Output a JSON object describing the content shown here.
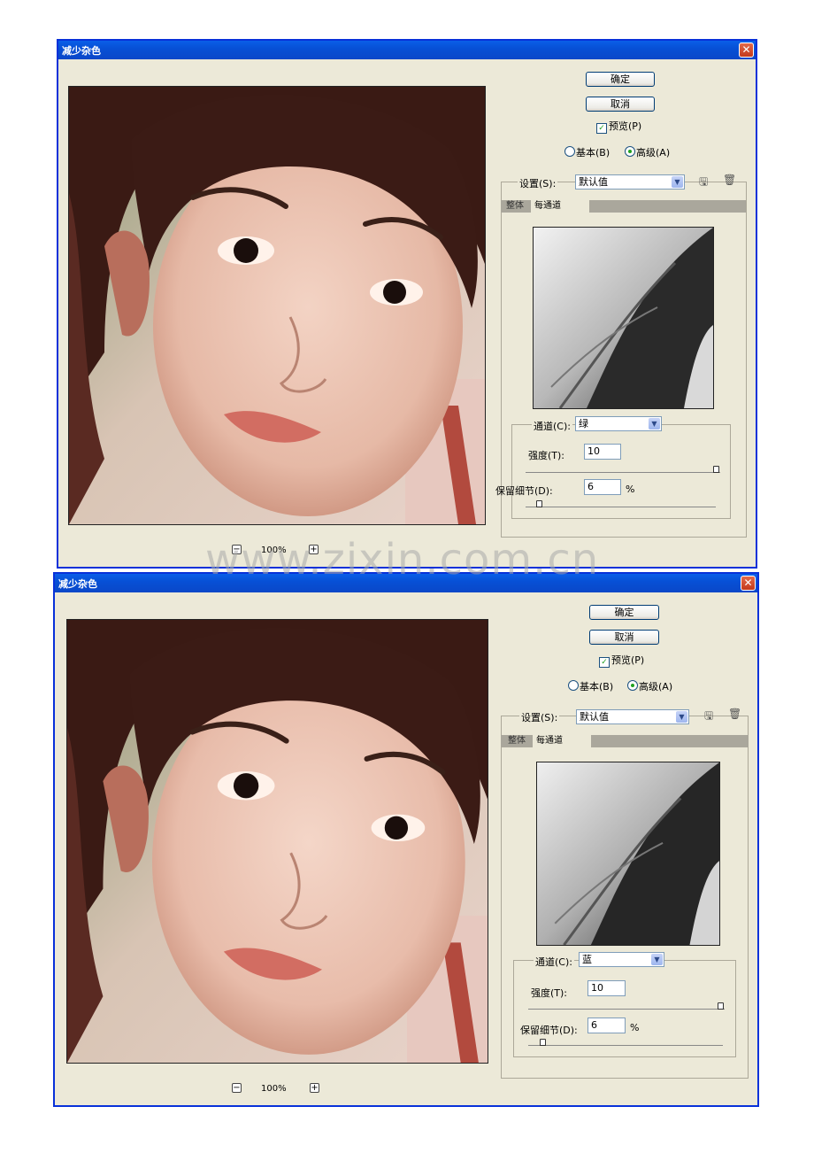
{
  "dialogs": [
    {
      "title": "减少杂色",
      "close_glyph": "✕",
      "ok_label": "确定",
      "cancel_label": "取消",
      "preview_label": "预览(P)",
      "basic_label": "基本(B)",
      "advanced_label": "高级(A)",
      "settings_label": "设置(S):",
      "settings_value": "默认值",
      "tab_overall": "整体",
      "tab_per_channel": "每通道",
      "channel_label": "通道(C):",
      "channel_value": "绿",
      "strength_label": "强度(T):",
      "strength_value": "10",
      "strength_level": 1.0,
      "detail_label": "保留细节(D):",
      "detail_value": "6",
      "detail_percent": 6,
      "percent_sign": "%",
      "zoom_out": "−",
      "zoom_value": "100%",
      "zoom_in": "+"
    },
    {
      "title": "减少杂色",
      "close_glyph": "✕",
      "ok_label": "确定",
      "cancel_label": "取消",
      "preview_label": "预览(P)",
      "basic_label": "基本(B)",
      "advanced_label": "高级(A)",
      "settings_label": "设置(S):",
      "settings_value": "默认值",
      "tab_overall": "整体",
      "tab_per_channel": "每通道",
      "channel_label": "通道(C):",
      "channel_value": "蓝",
      "strength_label": "强度(T):",
      "strength_value": "10",
      "strength_level": 1.0,
      "detail_label": "保留细节(D):",
      "detail_value": "6",
      "detail_percent": 6,
      "percent_sign": "%",
      "zoom_out": "−",
      "zoom_value": "100%",
      "zoom_in": "+"
    }
  ],
  "watermark": "www.zixin.com.cn",
  "colors": {
    "title_bar": "#0750d6",
    "dialog_bg": "#ece9d8",
    "close": "#c4391b",
    "check": "#21a121"
  },
  "icons": {
    "checkbox": "checkmark-icon",
    "dropdown": "chevron-down-icon",
    "save": "save-settings-icon",
    "delete": "trash-icon"
  }
}
